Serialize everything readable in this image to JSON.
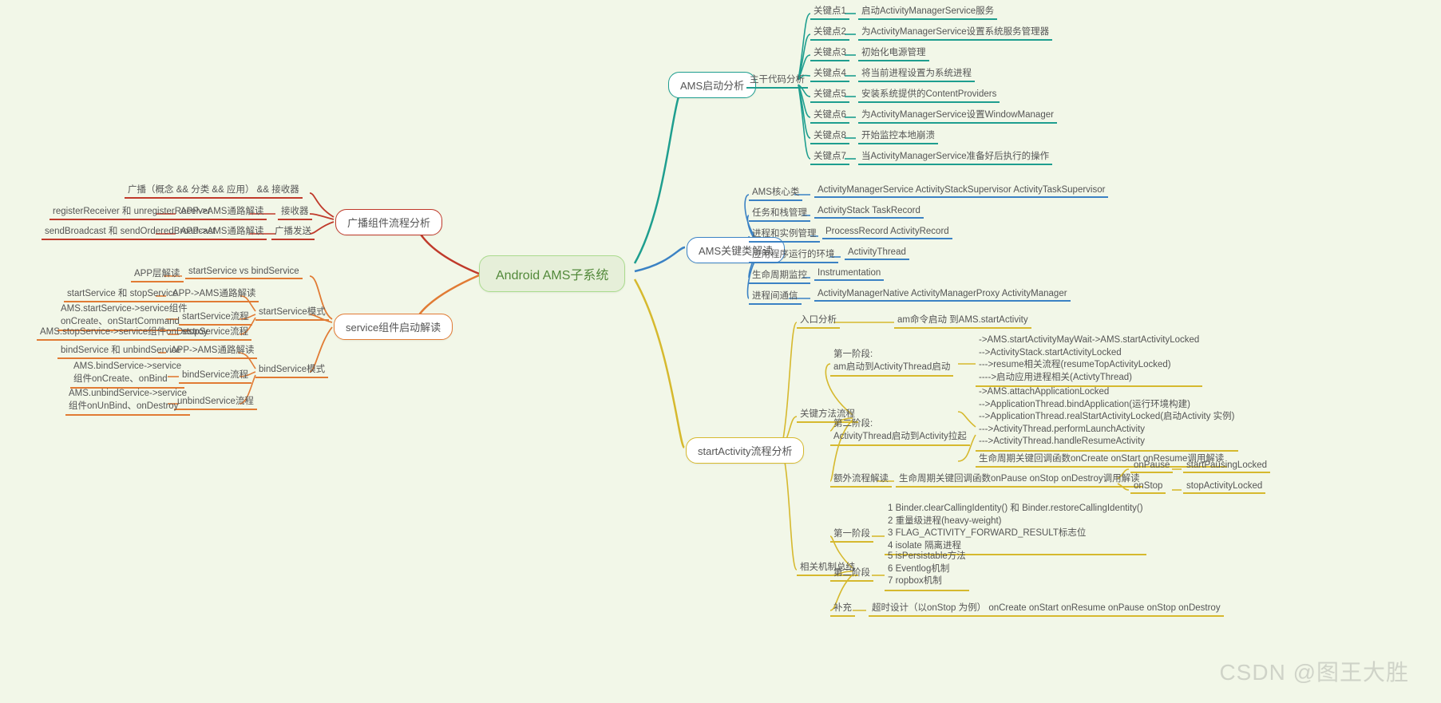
{
  "root": "Android AMS子系统",
  "branch1": {
    "title": "广播组件流程分析",
    "rows": [
      [
        "广播（概念 && 分类 && 应用）  && 接收器"
      ],
      [
        "registerReceiver 和 unregisterReceiver",
        "APP->AMS通路解读",
        "接收器"
      ],
      [
        "sendBroadcast 和 sendOrderedBroadcast",
        "APP->AMS通路解读",
        "广播发送"
      ]
    ]
  },
  "branch2": {
    "title": "service组件启动解读",
    "app_row": [
      "APP层解读",
      "startService vs bindService"
    ],
    "start_label": "startService模式",
    "start_rows": [
      [
        "startService 和 stopService",
        "APP->AMS通路解读"
      ],
      [
        "AMS.startService->service组件\nonCreate、onStartCommand",
        "startService流程"
      ],
      [
        "AMS.stopService->service组件onDestroy",
        "stopService流程"
      ]
    ],
    "bind_label": "bindService模式",
    "bind_rows": [
      [
        "bindService 和 unbindService",
        "APP->AMS通路解读"
      ],
      [
        "AMS.bindService->service\n组件onCreate、onBind",
        "bindService流程"
      ],
      [
        "AMS.unbindService->service\n组件onUnBind、onDestroy",
        "unbindService流程"
      ]
    ]
  },
  "branch3": {
    "title": "AMS启动分析",
    "mid": "主干代码分析",
    "rows": [
      [
        "关键点1",
        "启动ActivityManagerService服务"
      ],
      [
        "关键点2",
        "为ActivityManagerService设置系统服务管理器"
      ],
      [
        "关键点3",
        "初始化电源管理"
      ],
      [
        "关键点4",
        "将当前进程设置为系统进程"
      ],
      [
        "关键点5",
        "安装系统提供的ContentProviders"
      ],
      [
        "关键点6",
        "为ActivityManagerService设置WindowManager"
      ],
      [
        "关键点8",
        "开始监控本地崩溃"
      ],
      [
        "关键点7",
        "当ActivityManagerService准备好后执行的操作"
      ]
    ]
  },
  "branch4": {
    "title": "AMS关键类解读",
    "rows": [
      [
        "AMS核心类",
        "ActivityManagerService  ActivityStackSupervisor ActivityTaskSupervisor"
      ],
      [
        "任务和栈管理",
        "ActivityStack  TaskRecord"
      ],
      [
        "进程和实例管理",
        "ProcessRecord  ActivityRecord"
      ],
      [
        "应用程序运行的环境",
        "ActivityThread"
      ],
      [
        "生命周期监控",
        "Instrumentation"
      ],
      [
        "进程间通信",
        "ActivityManagerNative  ActivityManagerProxy ActivityManager"
      ]
    ]
  },
  "branch5": {
    "title": "startActivity流程分析",
    "entry": [
      "入口分析",
      "am命令启动 到AMS.startActivity"
    ],
    "key_label": "关键方法流程",
    "phase1_label": "第一阶段:\nam启动到ActivityThread启动",
    "phase1_body": "->AMS.startActivityMayWait->AMS.startActivityLocked\n-->ActivityStack.startActivityLocked\n--->resume相关流程(resumeTopActivityLocked)\n---->启动应用进程相关(ActivtyThread)",
    "phase2_label": "第二阶段:\nActivityThread启动到Activity拉起",
    "phase2_body": "->AMS.attachApplicationLocked\n-->ApplicationThread.bindApplication(运行环境构建)\n-->ApplicationThread.realStartActivityLocked(启动Activity 实例)\n--->ActivityThread.performLaunchActivity\n--->ActivityThread.handleResumeActivity",
    "phase2_extra": "生命周期关键回调函数onCreate onStart onResume调用解读",
    "extra_label": "额外流程解读",
    "extra_mid": "生命周期关键回调函数onPause onStop onDestroy调用解读",
    "extra_rows": [
      [
        "onPause",
        "startPausingLocked"
      ],
      [
        "onStop",
        "stopActivityLocked"
      ]
    ],
    "sum_label": "相关机制总结",
    "sum_p1_label": "第一阶段",
    "sum_p1_body": "1 Binder.clearCallingIdentity() 和 Binder.restoreCallingIdentity()\n2 重量级进程(heavy-weight)\n3 FLAG_ACTIVITY_FORWARD_RESULT标志位\n4 isolate 隔离进程",
    "sum_p2_label": "第二阶段",
    "sum_p2_body": "5 isPersistable方法\n6 Eventlog机制\n7 ropbox机制",
    "sum_extra": [
      "补充",
      "超时设计（以onStop 为例） onCreate onStart onResume onPause onStop onDestroy"
    ]
  },
  "watermark": "CSDN @图王大胜"
}
